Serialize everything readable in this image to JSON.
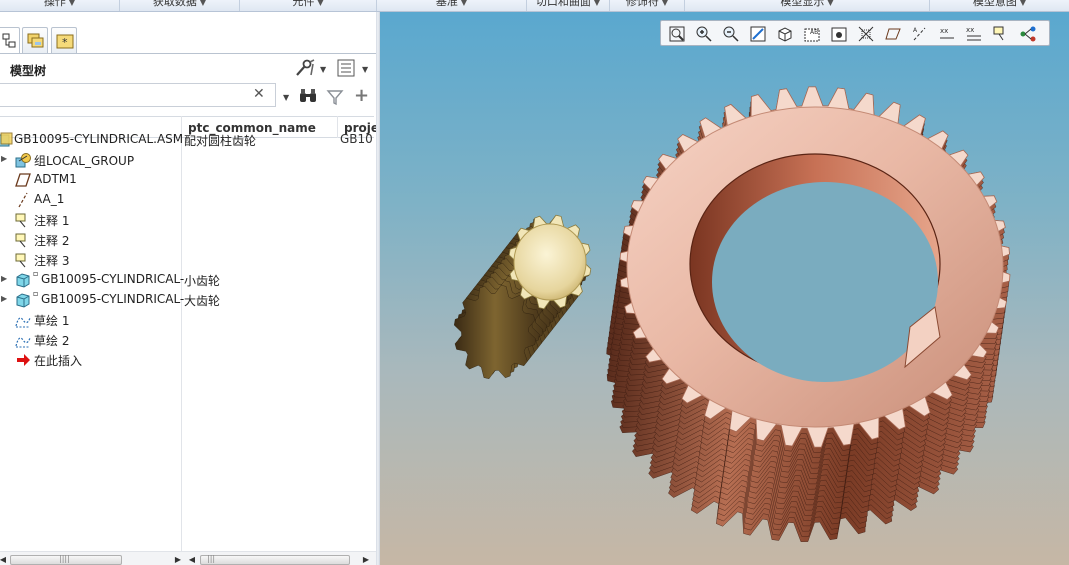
{
  "ribbon": {
    "groups": [
      {
        "label": "操作"
      },
      {
        "label": "获取数据"
      },
      {
        "label": "元件"
      },
      {
        "label": "基准"
      },
      {
        "label": "切口和曲面"
      },
      {
        "label": "修饰符"
      },
      {
        "label": "模型显示"
      },
      {
        "label": "模型意图"
      }
    ]
  },
  "model_tree": {
    "title": "模型树",
    "search_value": "",
    "columns": [
      "ptc_common_name",
      "proje"
    ],
    "rows": [
      {
        "label": "GB10095-CYLINDRICAL.ASM",
        "common_name": "配对圆柱齿轮",
        "project": "GB10",
        "icon": "assembly-icon",
        "expand": ""
      },
      {
        "label": "组LOCAL_GROUP",
        "common_name": "",
        "project": "",
        "icon": "group-icon",
        "expand": "▶"
      },
      {
        "label": "ADTM1",
        "common_name": "",
        "project": "",
        "icon": "datum-plane-icon",
        "expand": ""
      },
      {
        "label": "AA_1",
        "common_name": "",
        "project": "",
        "icon": "datum-axis-icon",
        "expand": ""
      },
      {
        "label": "注释 1",
        "common_name": "",
        "project": "",
        "icon": "annotation-icon",
        "expand": ""
      },
      {
        "label": "注释 2",
        "common_name": "",
        "project": "",
        "icon": "annotation-icon",
        "expand": ""
      },
      {
        "label": "注释 3",
        "common_name": "",
        "project": "",
        "icon": "annotation-icon",
        "expand": ""
      },
      {
        "label": "GB10095-CYLINDRICAL-",
        "common_name": "小齿轮",
        "project": "",
        "icon": "part-icon",
        "expand": "▶"
      },
      {
        "label": "GB10095-CYLINDRICAL-",
        "common_name": "大齿轮",
        "project": "",
        "icon": "part-icon",
        "expand": "▶"
      },
      {
        "label": "草绘 1",
        "common_name": "",
        "project": "",
        "icon": "sketch-icon",
        "expand": ""
      },
      {
        "label": "草绘 2",
        "common_name": "",
        "project": "",
        "icon": "sketch-icon",
        "expand": ""
      },
      {
        "label": "在此插入",
        "common_name": "",
        "project": "",
        "icon": "insert-here-arrow-icon",
        "expand": ""
      }
    ]
  },
  "graphics": {
    "toolbar_icons": [
      "refit-icon",
      "zoom-in-icon",
      "zoom-out-icon",
      "repaint-icon",
      "display-style-icon",
      "saved-views-icon",
      "view-manager-icon",
      "perspective-icon",
      "datum-planes-display-icon",
      "datum-axes-display-icon",
      "point-display-icon",
      "csys-display-icon",
      "annotation-display-icon",
      "spin-center-icon"
    ],
    "small_gear_teeth": 12,
    "large_gear_teeth": 42,
    "colors": {
      "copper": "#c9866a",
      "brass": "#e8dca8",
      "sky_top": "#5aa8cf",
      "sky_bottom": "#c6b7a5"
    }
  }
}
